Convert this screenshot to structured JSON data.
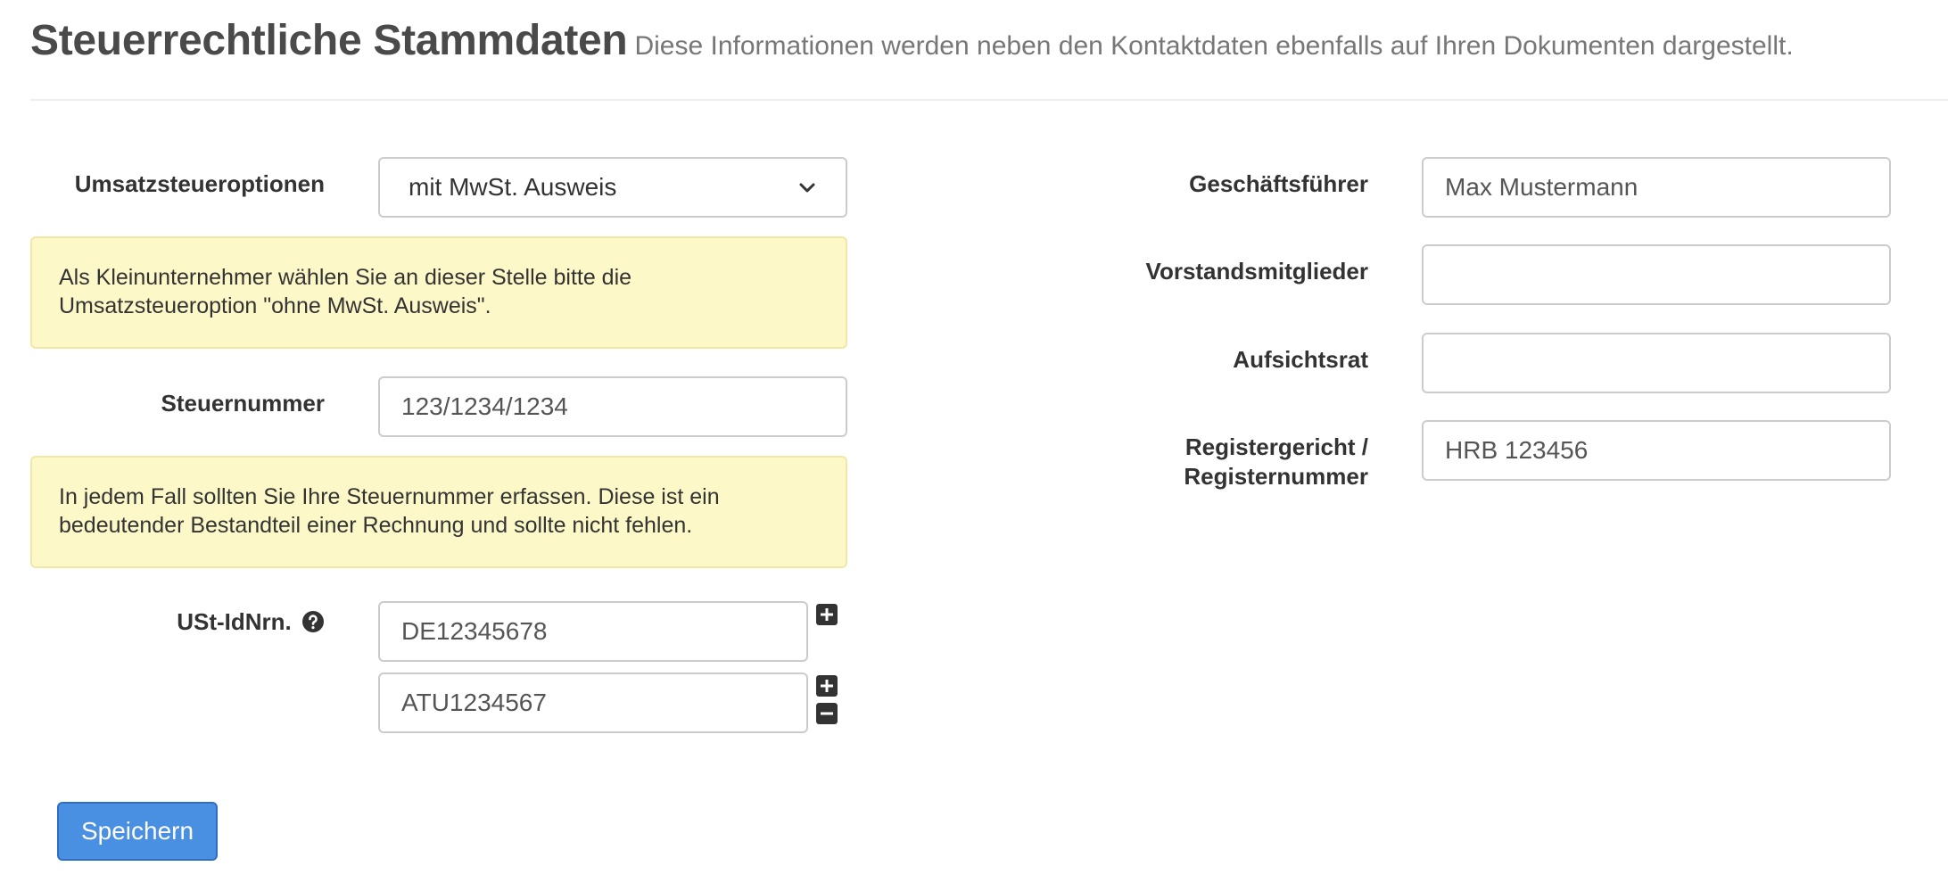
{
  "header": {
    "title": "Steuerrechtliche Stammdaten",
    "subtitle": "Diese Informationen werden neben den Kontaktdaten ebenfalls auf Ihren Dokumenten dargestellt."
  },
  "left": {
    "vat_option": {
      "label": "Umsatzsteueroptionen",
      "value": "mit MwSt. Ausweis"
    },
    "vat_hint": {
      "line1": "Als Kleinunternehmer wählen Sie an dieser Stelle bitte die",
      "line2": "Umsatzsteueroption \"ohne MwSt. Ausweis\"."
    },
    "tax_number": {
      "label": "Steuernummer",
      "value": "123/1234/1234"
    },
    "tax_hint": {
      "line1": "In jedem Fall sollten Sie Ihre Steuernummer erfassen. Diese ist ein",
      "line2": "bedeutender Bestandteil einer Rechnung und sollte nicht fehlen."
    },
    "vat_ids": {
      "label": "USt-IdNrn.",
      "values": [
        "DE12345678",
        "ATU1234567"
      ]
    }
  },
  "right": {
    "managing_director": {
      "label": "Geschäftsführer",
      "value": "Max Mustermann"
    },
    "board_members": {
      "label": "Vorstandsmitglieder",
      "value": ""
    },
    "supervisory_board": {
      "label": "Aufsichtsrat",
      "value": ""
    },
    "register": {
      "label_line1": "Registergericht /",
      "label_line2": "Registernummer",
      "value": "HRB 123456"
    }
  },
  "actions": {
    "save_label": "Speichern"
  },
  "colors": {
    "primary_button": "#4a90e2",
    "alert_background": "#fcf8c7",
    "title_text": "#4a4a4a"
  },
  "icons": {
    "vat_dropdown": "chevron-down-icon",
    "vat_id_help": "question-circle-icon",
    "add_vat_id": "plus-square-icon",
    "remove_vat_id": "minus-square-icon"
  }
}
